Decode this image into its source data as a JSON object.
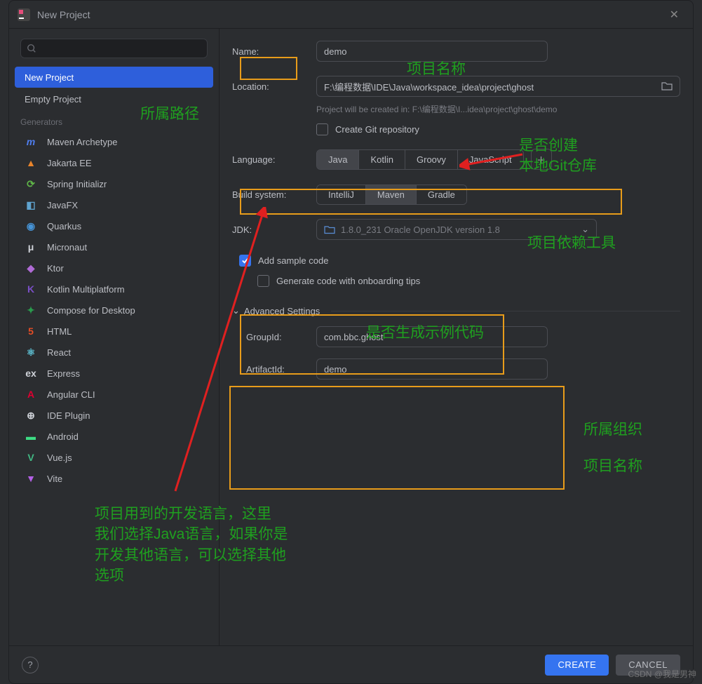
{
  "window": {
    "title": "New Project"
  },
  "sidebar": {
    "search_placeholder": "",
    "items": [
      {
        "label": "New Project",
        "selected": true
      },
      {
        "label": "Empty Project",
        "selected": false
      }
    ],
    "generators_label": "Generators",
    "generators": [
      {
        "label": "Maven Archetype",
        "icon": "m",
        "color": "#4f7ef0",
        "italic": true
      },
      {
        "label": "Jakarta EE",
        "icon": "▲",
        "color": "#e8842b"
      },
      {
        "label": "Spring Initializr",
        "icon": "⟳",
        "color": "#5fb548"
      },
      {
        "label": "JavaFX",
        "icon": "◧",
        "color": "#5fa3cf"
      },
      {
        "label": "Quarkus",
        "icon": "◉",
        "color": "#4693d6"
      },
      {
        "label": "Micronaut",
        "icon": "μ",
        "color": "#cfd2d8"
      },
      {
        "label": "Ktor",
        "icon": "◆",
        "color": "#b06bd6"
      },
      {
        "label": "Kotlin Multiplatform",
        "icon": "K",
        "color": "#7a4fc7"
      },
      {
        "label": "Compose for Desktop",
        "icon": "✦",
        "color": "#2a9a4d"
      },
      {
        "label": "HTML",
        "icon": "5",
        "color": "#e44d26"
      },
      {
        "label": "React",
        "icon": "⚛",
        "color": "#5fc4d8"
      },
      {
        "label": "Express",
        "icon": "ex",
        "color": "#cfd2d8"
      },
      {
        "label": "Angular CLI",
        "icon": "A",
        "color": "#dd0031"
      },
      {
        "label": "IDE Plugin",
        "icon": "⊕",
        "color": "#cfd2d8"
      },
      {
        "label": "Android",
        "icon": "▬",
        "color": "#3ddc84"
      },
      {
        "label": "Vue.js",
        "icon": "V",
        "color": "#41b883"
      },
      {
        "label": "Vite",
        "icon": "▼",
        "color": "#b460e6"
      }
    ]
  },
  "form": {
    "name_label": "Name:",
    "name_value": "demo",
    "location_label": "Location:",
    "location_value": "F:\\编程数据\\IDE\\Java\\workspace_idea\\project\\ghost",
    "created_in_hint": "Project will be created in: F:\\编程数据\\I...idea\\project\\ghost\\demo",
    "git_label": "Create Git repository",
    "language_label": "Language:",
    "languages": [
      "Java",
      "Kotlin",
      "Groovy",
      "JavaScript"
    ],
    "language_selected": "Java",
    "build_label": "Build system:",
    "build_systems": [
      "IntelliJ",
      "Maven",
      "Gradle"
    ],
    "build_selected": "Maven",
    "jdk_label": "JDK:",
    "jdk_value": "1.8.0_231 Oracle OpenJDK version 1.8",
    "sample_label": "Add sample code",
    "onboarding_label": "Generate code with onboarding tips",
    "advanced_label": "Advanced Settings",
    "groupid_label": "GroupId:",
    "groupid_value": "com.bbc.ghost",
    "artifactid_label": "ArtifactId:",
    "artifactid_value": "demo"
  },
  "buttons": {
    "create": "CREATE",
    "cancel": "CANCEL",
    "help": "?"
  },
  "annotations": {
    "name": "项目名称",
    "location": "所属路径",
    "git": "是否创建\n本地Git仓库",
    "build": "项目依赖工具",
    "sample": "是否生成示例代码",
    "group_org": "所属组织",
    "artifact_name": "项目名称",
    "lang_note": "项目用到的开发语言，这里\n我们选择Java语言，如果你是\n开发其他语言，可以选择其他\n选项"
  },
  "watermark": "CSDN @我是男神"
}
